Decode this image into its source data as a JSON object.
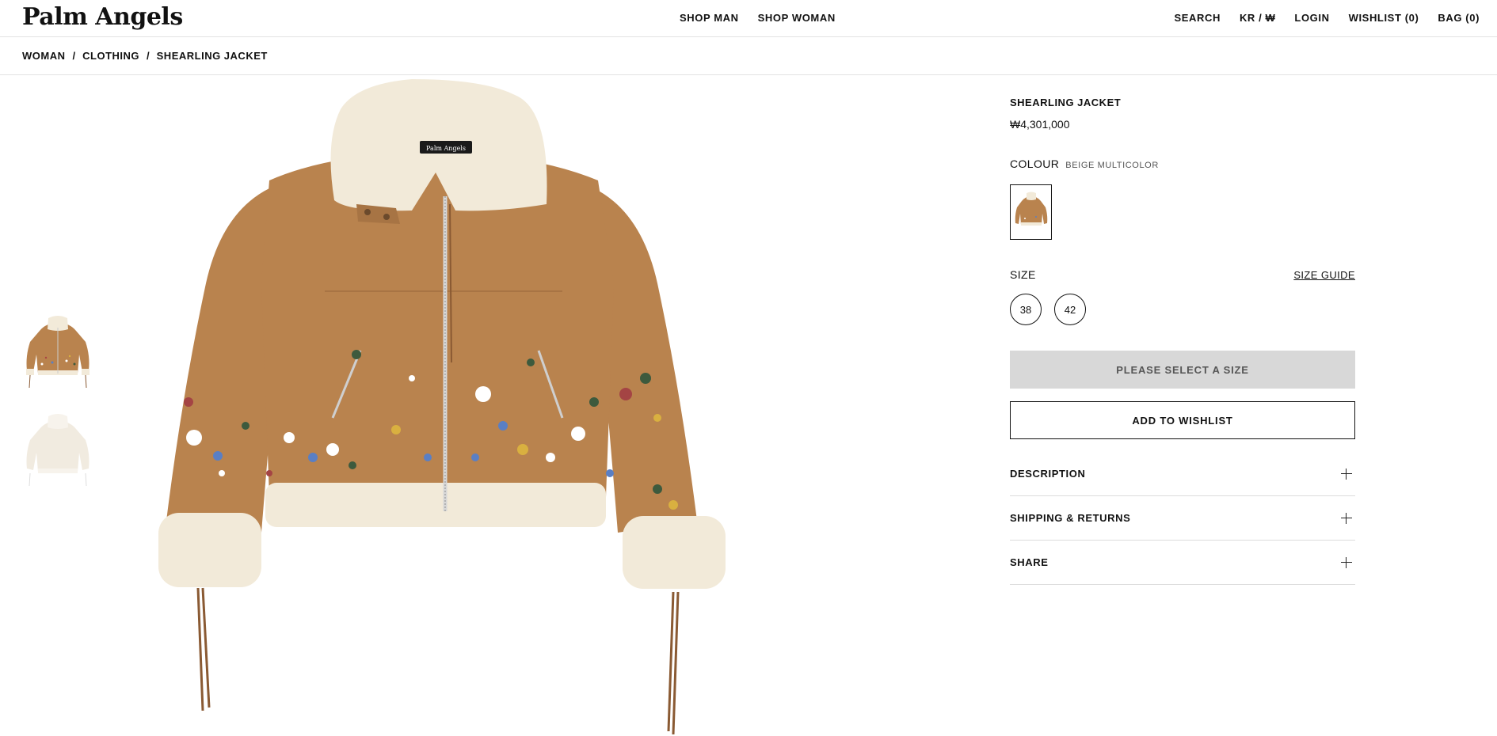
{
  "header": {
    "logo": "Palm Angels",
    "nav_center": [
      "SHOP MAN",
      "SHOP WOMAN"
    ],
    "nav_right": {
      "search": "SEARCH",
      "locale": "KR / ₩",
      "login": "LOGIN",
      "wishlist": "WISHLIST (0)",
      "bag": "BAG (0)"
    }
  },
  "breadcrumb": {
    "items": [
      "WOMAN",
      "CLOTHING",
      "SHEARLING JACKET"
    ],
    "separator": "/"
  },
  "gallery": {
    "thumbnails": [
      "front-view",
      "back-view"
    ],
    "main_colors": {
      "suede": "#b9834e",
      "fur": "#f2ead9",
      "fringe": "#8a5a33"
    },
    "collar_label": "Palm Angels"
  },
  "product": {
    "title": "SHEARLING JACKET",
    "price": "₩4,301,000",
    "colour_label": "COLOUR",
    "colour_value": "BEIGE MULTICOLOR",
    "size_label": "SIZE",
    "size_guide": "SIZE GUIDE",
    "sizes": [
      "38",
      "42"
    ],
    "select_button": "PLEASE SELECT A SIZE",
    "wishlist_button": "ADD TO WISHLIST",
    "accordion": [
      "DESCRIPTION",
      "SHIPPING & RETURNS",
      "SHARE"
    ]
  }
}
